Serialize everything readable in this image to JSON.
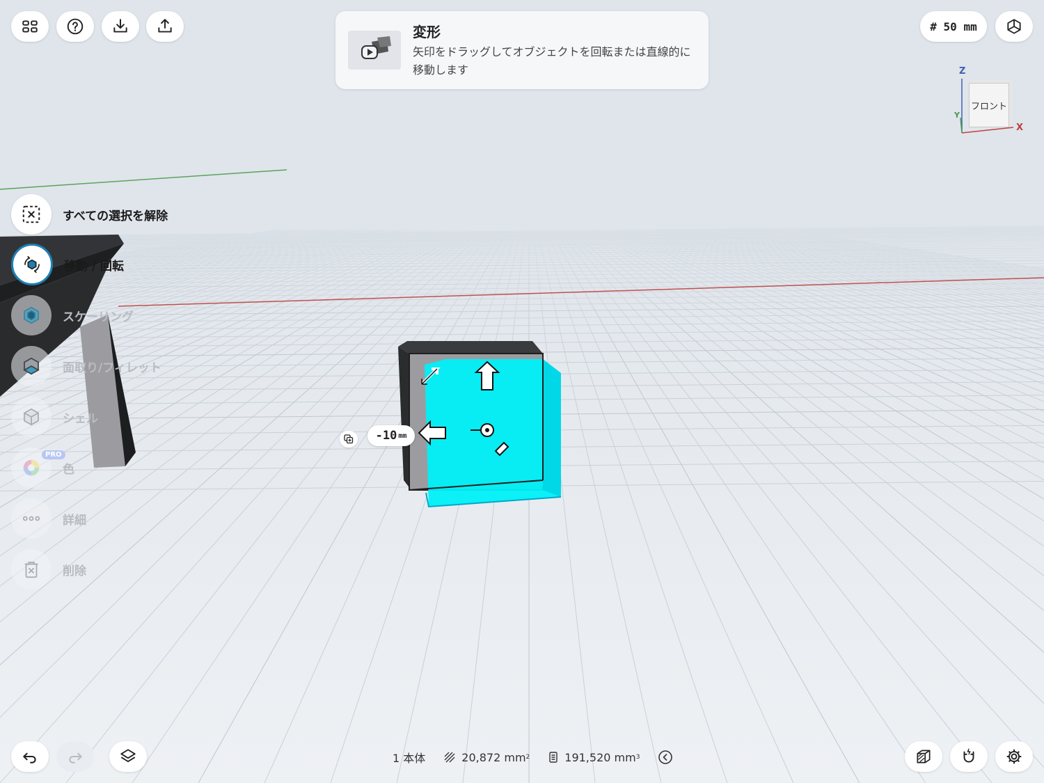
{
  "top_toolbar": {
    "grid_icon": "grid-icon",
    "help_icon": "help-icon",
    "import_icon": "download-icon",
    "export_icon": "share-icon"
  },
  "tooltip": {
    "title": "変形",
    "description": "矢印をドラッグしてオブジェクトを回転または直線的に移動します",
    "thumbnail_icon": "video-play-icon"
  },
  "grid_size": {
    "label": "# 50 mm"
  },
  "viewcube": {
    "face_label": "フロント",
    "axis_z": "Z",
    "axis_y": "Y",
    "axis_x": "X"
  },
  "tools": {
    "items": [
      {
        "label": "すべての選択を解除",
        "icon": "deselect-icon",
        "state": "enabled"
      },
      {
        "label": "移動 / 回転",
        "icon": "move-rotate-icon",
        "state": "active"
      },
      {
        "label": "スケーリング",
        "icon": "scale-icon",
        "state": "disabled"
      },
      {
        "label": "面取り/フィレット",
        "icon": "fillet-icon",
        "state": "disabled"
      },
      {
        "label": "シェル",
        "icon": "shell-icon",
        "state": "disabled"
      },
      {
        "label": "色",
        "icon": "color-icon",
        "state": "disabled",
        "badge": "PRO"
      },
      {
        "label": "詳細",
        "icon": "more-icon",
        "state": "disabled"
      },
      {
        "label": "削除",
        "icon": "trash-icon",
        "state": "disabled"
      }
    ]
  },
  "gizmo": {
    "distance_value": "-10",
    "distance_unit": "mm"
  },
  "status_bar": {
    "bodies": "1 本体",
    "area_value": "20,872 mm",
    "area_exp": "2",
    "volume_value": "191,520 mm",
    "volume_exp": "3"
  },
  "bottom_toolbar": {
    "undo_icon": "undo-icon",
    "redo_icon": "redo-icon",
    "layers_icon": "layers-icon",
    "section_icon": "section-view-icon",
    "snap_icon": "magnet-icon",
    "settings_icon": "settings-gear-icon"
  },
  "colors": {
    "selection": "#00f0f8",
    "active_tool": "#1f7fb5",
    "x_axis": "#c04040",
    "y_axis": "#4a9a4a"
  }
}
